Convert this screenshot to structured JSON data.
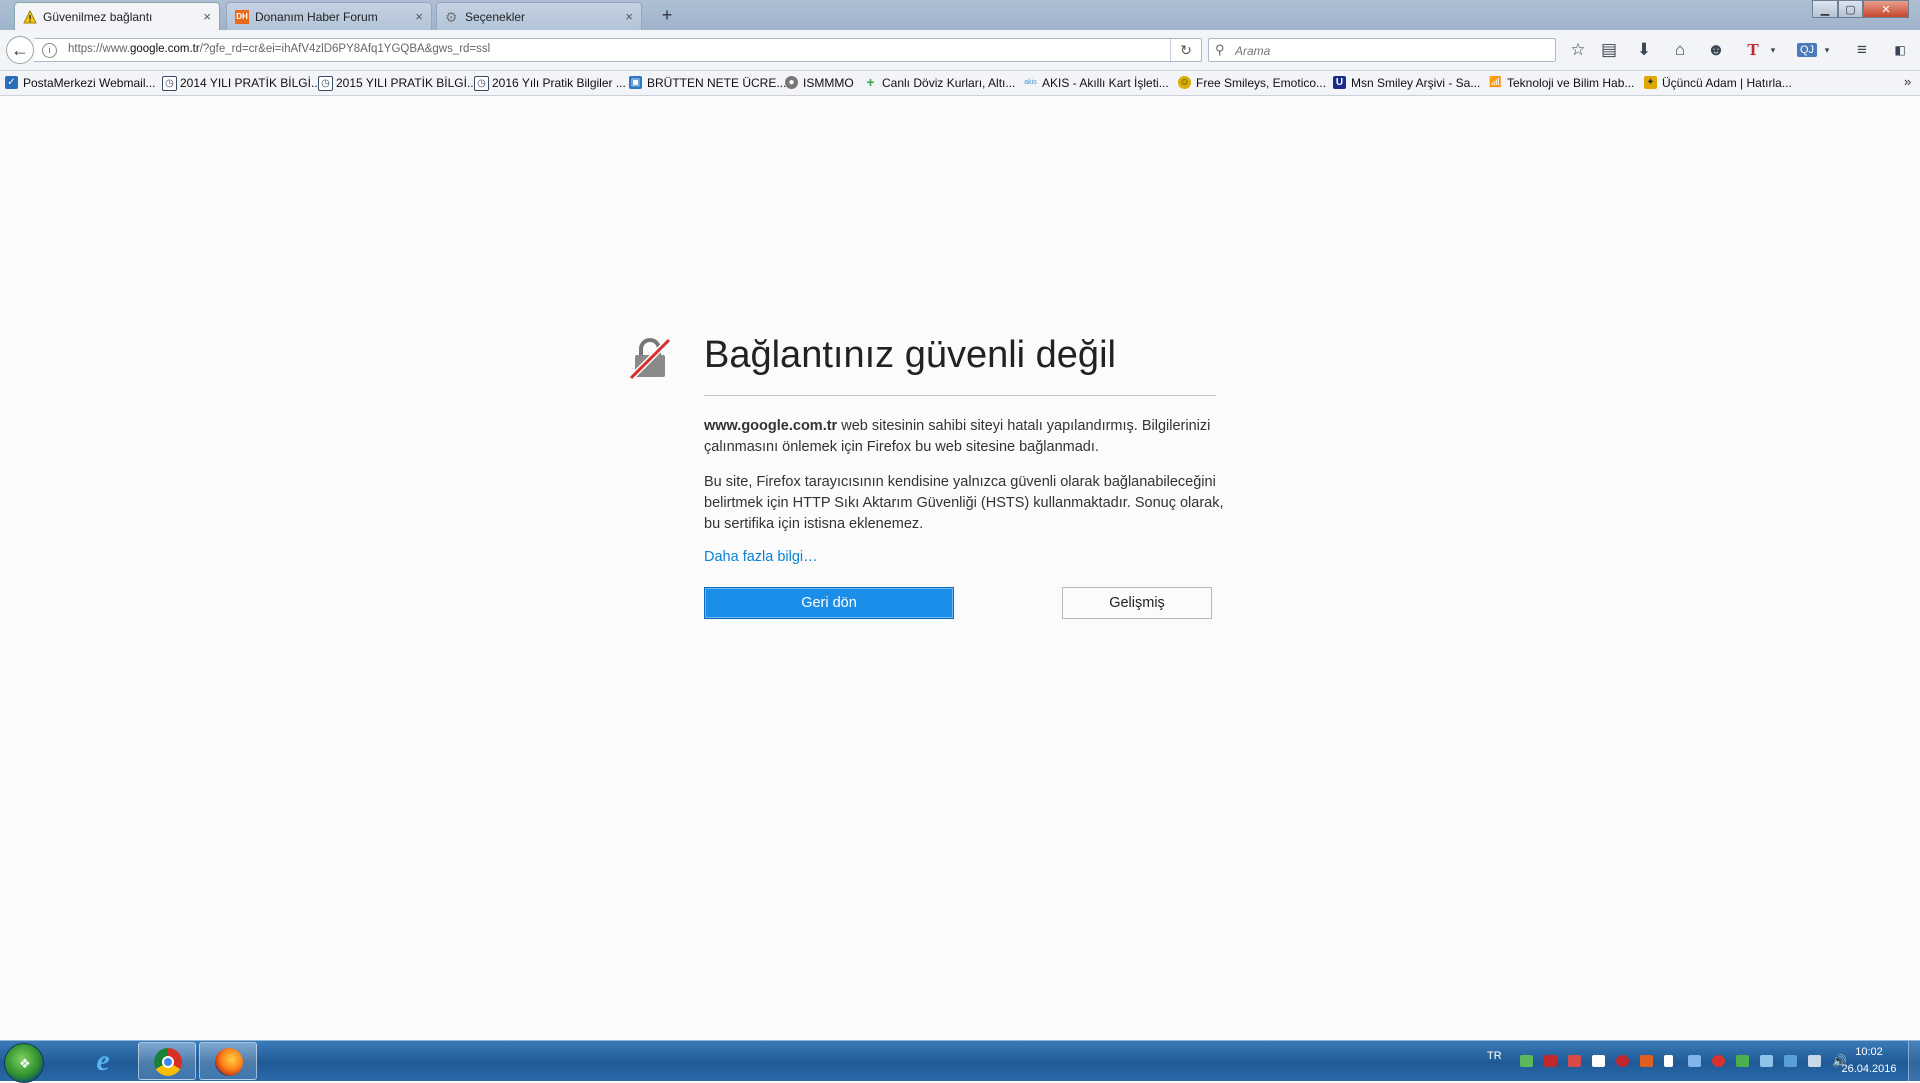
{
  "tabs": [
    {
      "title": "Güvenilmez bağlantı",
      "icon": "warning-icon",
      "active": true
    },
    {
      "title": "Donanım Haber Forum",
      "icon": "dh-favicon",
      "active": false
    },
    {
      "title": "Seçenekler",
      "icon": "gear-icon",
      "active": false
    }
  ],
  "tab_close": "×",
  "new_tab": "+",
  "window_controls": {
    "minimize": "▁",
    "maximize": "▢",
    "close": "✕"
  },
  "navbar": {
    "url_prefix": "https://www.",
    "url_host": "google.com.tr",
    "url_path": "/?gfe_rd=cr&ei=ihAfV4zlD6PY8Afq1YGQBA&gws_rd=ssl",
    "search_placeholder": "Arama"
  },
  "bookmarks": [
    {
      "label": "PostaMerkezi Webmail...",
      "icon": "check-icon",
      "color": "#2a6db8"
    },
    {
      "label": "2014 YILI PRATİK BİLGİ...",
      "icon": "clock-icon",
      "color": "#3a4b66"
    },
    {
      "label": "2015 YILI PRATİK BİLGİ...",
      "icon": "clock-icon",
      "color": "#3a4b66"
    },
    {
      "label": "2016 Yılı Pratik Bilgiler ...",
      "icon": "clock-icon",
      "color": "#3a4b66"
    },
    {
      "label": "BRÜTTEN NETE ÜCRE...",
      "icon": "calc-icon",
      "color": "#2a78c4"
    },
    {
      "label": "ISMMMO",
      "icon": "globe-icon",
      "color": "#777777"
    },
    {
      "label": "Canlı Döviz Kurları, Altı...",
      "icon": "plus-icon",
      "color": "#3aa84a"
    },
    {
      "label": "AKIS - Akıllı Kart İşleti...",
      "icon": "akis-icon",
      "color": "#4a90d0"
    },
    {
      "label": "Free Smileys, Emotico...",
      "icon": "smiley-icon",
      "color": "#d9b000"
    },
    {
      "label": "Msn Smiley Arşivi - Sa...",
      "icon": "u-icon",
      "color": "#1a2b8a"
    },
    {
      "label": "Teknoloji ve Bilim Hab...",
      "icon": "signal-icon",
      "color": "#555555"
    },
    {
      "label": "Üçüncü Adam | Hatırla...",
      "icon": "bulb-icon",
      "color": "#e0a800"
    }
  ],
  "bookmarks_overflow": "»",
  "error": {
    "title": "Bağlantınız güvenli değil",
    "p1_host": "www.google.com.tr",
    "p1_rest": " web sitesinin sahibi siteyi hatalı yapılandırmış. Bilgilerinizi çalınmasını önlemek için Firefox bu web sitesine bağlanmadı.",
    "p2": "Bu site, Firefox tarayıcısının kendisine yalnızca güvenli olarak bağlanabileceğini belirtmek için HTTP Sıkı Aktarım Güvenliği (HSTS) kullanmaktadır. Sonuç olarak, bu sertifika için istisna eklenemez.",
    "learn_more": "Daha fazla bilgi…",
    "back_button": "Geri dön",
    "advanced_button": "Gelişmiş"
  },
  "taskbar": {
    "language": "TR",
    "time": "10:02",
    "date": "26.04.2016",
    "apps": [
      "internet-explorer-icon",
      "chrome-icon",
      "firefox-icon"
    ]
  },
  "colors": {
    "accent": "#1a8ee8",
    "link": "#0a84d6",
    "lock_strike": "#d92d2d"
  }
}
